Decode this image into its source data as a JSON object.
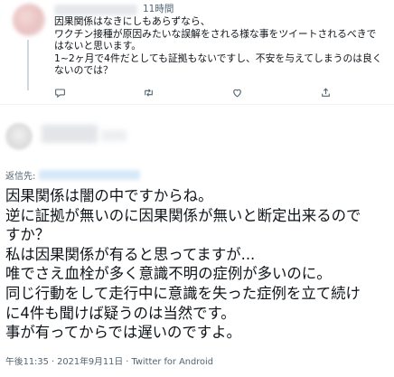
{
  "reply_tweet": {
    "time": "11時間",
    "text_lines": [
      "因果関係はなきにしもあらずなら、",
      "ワクチン接種が原因みたいな誤解をされる様な事をツイートされるべきで",
      "はないと思います。",
      "1~2ヶ月で4件だとしても証拠もないですし、不安を与えてしまうのは良く",
      "ないのでは？"
    ],
    "actions": [
      {
        "icon": "comment-icon"
      },
      {
        "icon": "retweet-icon"
      },
      {
        "icon": "like-icon"
      },
      {
        "icon": "share-icon"
      }
    ]
  },
  "main_tweet": {
    "reply_to_label": "返信先:",
    "text_lines": [
      "因果関係は闇の中ですからね。",
      "逆に証拠が無いのに因果関係が無いと断定出来るので",
      "すか？",
      "私は因果関係が有ると思ってますが...",
      "唯でさえ血栓が多く意識不明の症例が多いのに。",
      "同じ行動をして走行中に意識を失った症例を立て続け",
      "に4件も聞けば疑うのは当然です。",
      "事が有ってからでは遅いのですよ。"
    ],
    "timestamp": "午後11:35 · 2021年9月11日 · Twitter for Android"
  },
  "colors": {
    "text": "#0f1419",
    "secondary": "#536471",
    "divider": "#eff3f4"
  }
}
